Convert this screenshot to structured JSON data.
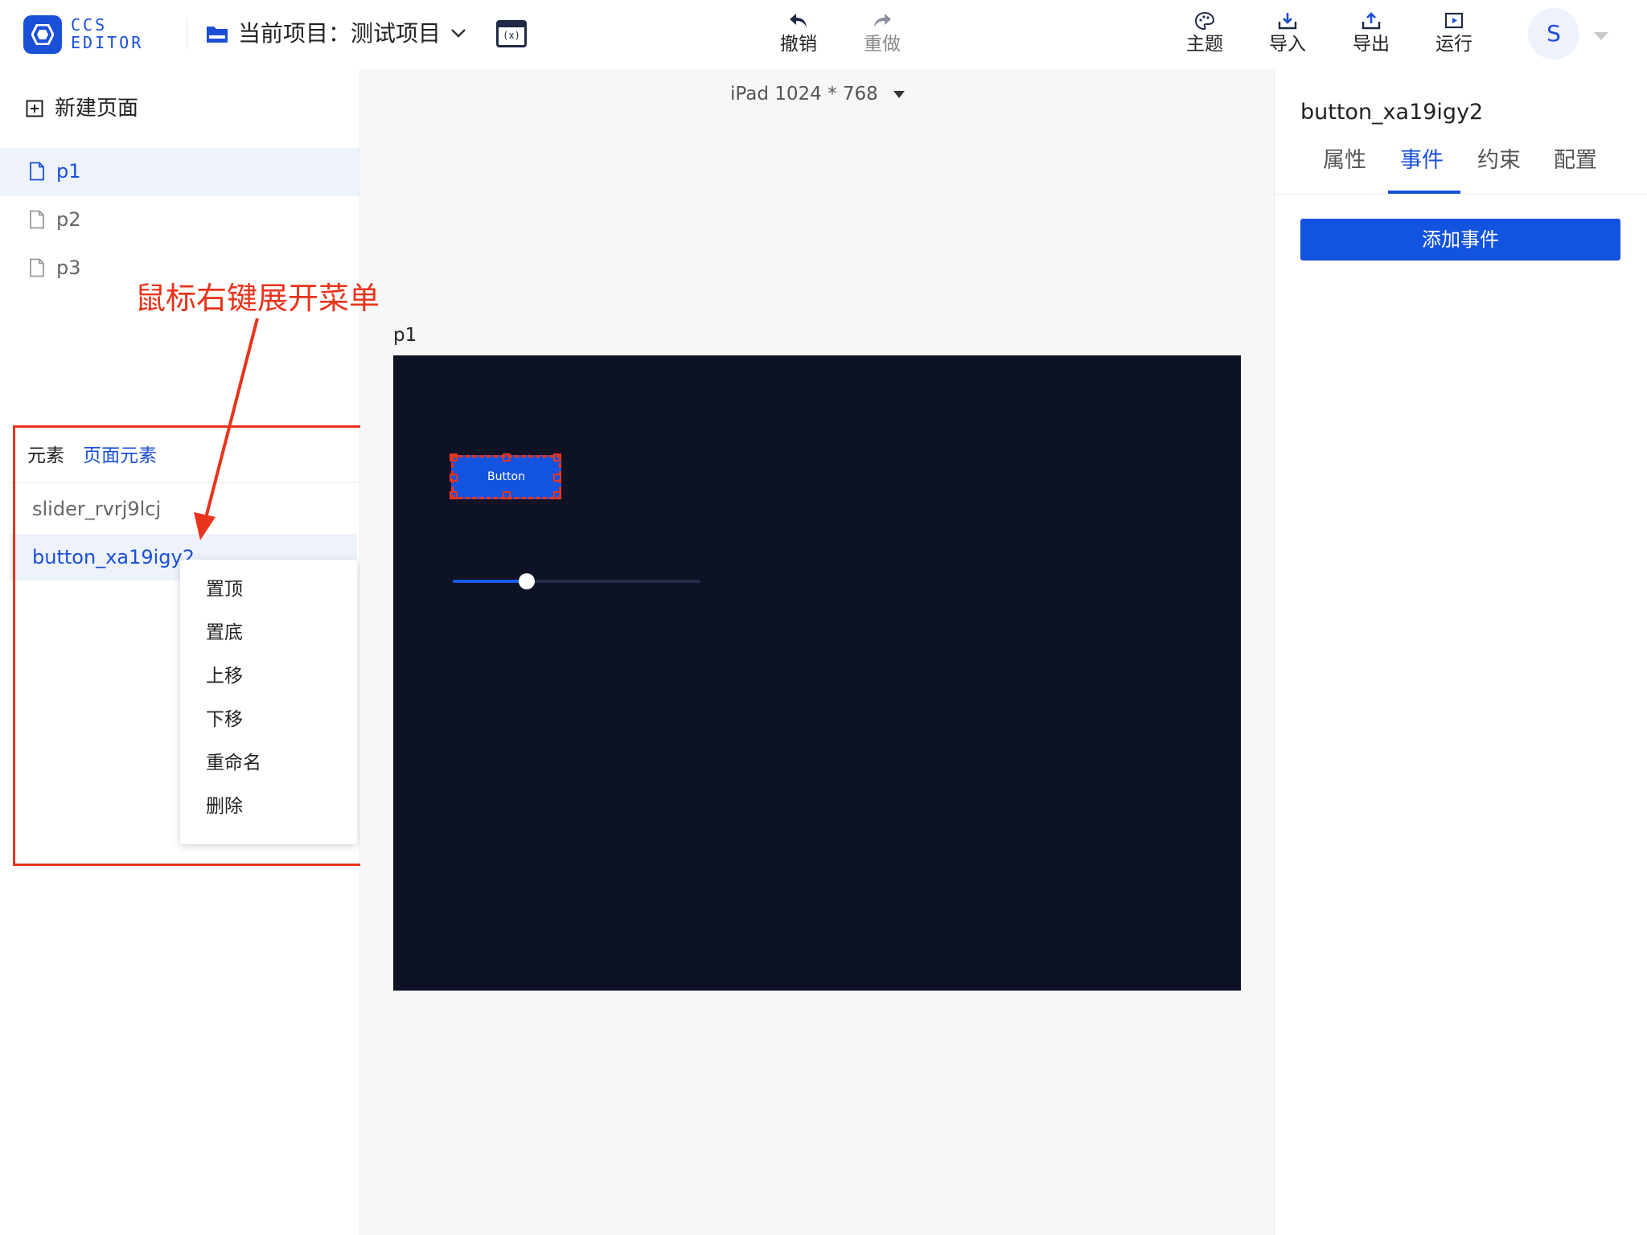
{
  "app": {
    "logo_line1": "CCS",
    "logo_line2": "EDITOR",
    "project_label": "当前项目：测试项目",
    "brand_color": "#1a4fd8"
  },
  "toolbar": {
    "undo": "撤销",
    "redo": "重做",
    "theme": "主题",
    "import": "导入",
    "export": "导出",
    "run": "运行"
  },
  "user": {
    "avatar_letter": "S"
  },
  "left_panel": {
    "new_page": "新建页面",
    "pages": [
      {
        "label": "p1",
        "active": true
      },
      {
        "label": "p2",
        "active": false
      },
      {
        "label": "p3",
        "active": false
      }
    ],
    "element_tabs": [
      "元素",
      "页面元素"
    ],
    "elements": [
      {
        "label": "slider_rvrj9lcj",
        "active": false
      },
      {
        "label": "button_xa19igy2",
        "active": true
      }
    ],
    "context_menu": [
      "置顶",
      "置底",
      "上移",
      "下移",
      "重命名",
      "删除"
    ]
  },
  "annotation": {
    "text": "鼠标右键展开菜单",
    "color": "#e8341c"
  },
  "canvas": {
    "device": "iPad 1024 * 768",
    "page_title": "p1",
    "button_label": "Button",
    "stage_color": "#0e1225",
    "slider_value_fraction": 0.3
  },
  "right_panel": {
    "selected": "button_xa19igy2",
    "tabs": [
      "属性",
      "事件",
      "约束",
      "配置"
    ],
    "active_tab": "事件",
    "add_event": "添加事件"
  }
}
